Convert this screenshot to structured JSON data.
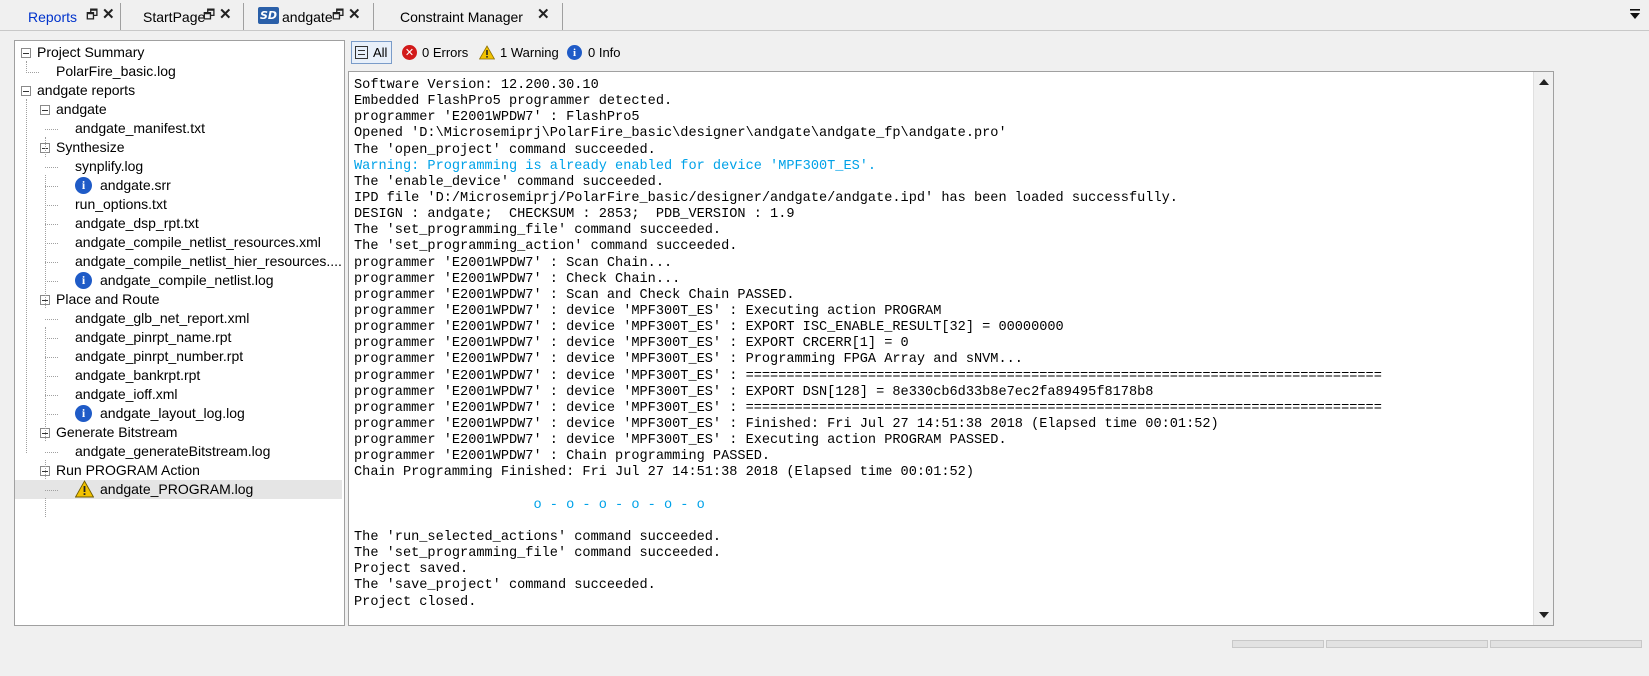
{
  "tabs": [
    {
      "label": "Reports",
      "active": true
    },
    {
      "label": "StartPage",
      "active": false
    },
    {
      "label": "andgate",
      "active": false,
      "badge": "SD"
    },
    {
      "label": "Constraint Manager",
      "active": false
    }
  ],
  "tree": {
    "nodes": [
      {
        "label": "Project Summary",
        "icon": "expander"
      },
      {
        "label": "PolarFire_basic.log",
        "icon": "none"
      },
      {
        "label": "andgate reports",
        "icon": "expander"
      },
      {
        "label": "andgate",
        "icon": "expander"
      },
      {
        "label": "andgate_manifest.txt",
        "icon": "none"
      },
      {
        "label": "Synthesize",
        "icon": "expander"
      },
      {
        "label": "synplify.log",
        "icon": "none"
      },
      {
        "label": "andgate.srr",
        "icon": "info"
      },
      {
        "label": "run_options.txt",
        "icon": "none"
      },
      {
        "label": "andgate_dsp_rpt.txt",
        "icon": "none"
      },
      {
        "label": "andgate_compile_netlist_resources.xml",
        "icon": "none"
      },
      {
        "label": "andgate_compile_netlist_hier_resources....",
        "icon": "none"
      },
      {
        "label": "andgate_compile_netlist.log",
        "icon": "info"
      },
      {
        "label": "Place and Route",
        "icon": "expander"
      },
      {
        "label": "andgate_glb_net_report.xml",
        "icon": "none"
      },
      {
        "label": "andgate_pinrpt_name.rpt",
        "icon": "none"
      },
      {
        "label": "andgate_pinrpt_number.rpt",
        "icon": "none"
      },
      {
        "label": "andgate_bankrpt.rpt",
        "icon": "none"
      },
      {
        "label": "andgate_ioff.xml",
        "icon": "none"
      },
      {
        "label": "andgate_layout_log.log",
        "icon": "info"
      },
      {
        "label": "Generate Bitstream",
        "icon": "expander"
      },
      {
        "label": "andgate_generateBitstream.log",
        "icon": "none"
      },
      {
        "label": "Run PROGRAM Action",
        "icon": "expander"
      },
      {
        "label": "andgate_PROGRAM.log",
        "icon": "warning",
        "selected": true
      }
    ]
  },
  "filters": {
    "all": "All",
    "errors": "0 Errors",
    "warnings": "1 Warning",
    "info": "0 Info"
  },
  "log": {
    "lines": [
      {
        "text": "Software Version: 12.200.30.10",
        "kind": "normal"
      },
      {
        "text": "Embedded FlashPro5 programmer detected.",
        "kind": "normal"
      },
      {
        "text": "programmer 'E2001WPDW7' : FlashPro5",
        "kind": "normal"
      },
      {
        "text": "Opened 'D:\\Microsemiprj\\PolarFire_basic\\designer\\andgate\\andgate_fp\\andgate.pro'",
        "kind": "normal"
      },
      {
        "text": "The 'open_project' command succeeded.",
        "kind": "normal"
      },
      {
        "text": "Warning: Programming is already enabled for device 'MPF300T_ES'.",
        "kind": "warn"
      },
      {
        "text": "The 'enable_device' command succeeded.",
        "kind": "normal"
      },
      {
        "text": "IPD file 'D:/Microsemiprj/PolarFire_basic/designer/andgate/andgate.ipd' has been loaded successfully.",
        "kind": "normal"
      },
      {
        "text": "DESIGN : andgate;  CHECKSUM : 2853;  PDB_VERSION : 1.9",
        "kind": "normal"
      },
      {
        "text": "The 'set_programming_file' command succeeded.",
        "kind": "normal"
      },
      {
        "text": "The 'set_programming_action' command succeeded.",
        "kind": "normal"
      },
      {
        "text": "programmer 'E2001WPDW7' : Scan Chain...",
        "kind": "normal"
      },
      {
        "text": "programmer 'E2001WPDW7' : Check Chain...",
        "kind": "normal"
      },
      {
        "text": "programmer 'E2001WPDW7' : Scan and Check Chain PASSED.",
        "kind": "normal"
      },
      {
        "text": "programmer 'E2001WPDW7' : device 'MPF300T_ES' : Executing action PROGRAM",
        "kind": "normal"
      },
      {
        "text": "programmer 'E2001WPDW7' : device 'MPF300T_ES' : EXPORT ISC_ENABLE_RESULT[32] = 00000000",
        "kind": "normal"
      },
      {
        "text": "programmer 'E2001WPDW7' : device 'MPF300T_ES' : EXPORT CRCERR[1] = 0",
        "kind": "normal"
      },
      {
        "text": "programmer 'E2001WPDW7' : device 'MPF300T_ES' : Programming FPGA Array and sNVM...",
        "kind": "normal"
      },
      {
        "text": "programmer 'E2001WPDW7' : device 'MPF300T_ES' : ==============================================================================",
        "kind": "normal"
      },
      {
        "text": "programmer 'E2001WPDW7' : device 'MPF300T_ES' : EXPORT DSN[128] = 8e330cb6d33b8e7ec2fa89495f8178b8",
        "kind": "normal"
      },
      {
        "text": "programmer 'E2001WPDW7' : device 'MPF300T_ES' : ==============================================================================",
        "kind": "normal"
      },
      {
        "text": "programmer 'E2001WPDW7' : device 'MPF300T_ES' : Finished: Fri Jul 27 14:51:38 2018 (Elapsed time 00:01:52)",
        "kind": "normal"
      },
      {
        "text": "programmer 'E2001WPDW7' : device 'MPF300T_ES' : Executing action PROGRAM PASSED.",
        "kind": "normal"
      },
      {
        "text": "programmer 'E2001WPDW7' : Chain programming PASSED.",
        "kind": "normal"
      },
      {
        "text": "Chain Programming Finished: Fri Jul 27 14:51:38 2018 (Elapsed time 00:01:52)",
        "kind": "normal"
      },
      {
        "text": "",
        "kind": "normal"
      },
      {
        "text": "                      o - o - o - o - o - o",
        "kind": "sep"
      },
      {
        "text": "",
        "kind": "normal"
      },
      {
        "text": "The 'run_selected_actions' command succeeded.",
        "kind": "normal"
      },
      {
        "text": "The 'set_programming_file' command succeeded.",
        "kind": "normal"
      },
      {
        "text": "Project saved.",
        "kind": "normal"
      },
      {
        "text": "The 'save_project' command succeeded.",
        "kind": "normal"
      },
      {
        "text": "Project closed.",
        "kind": "normal"
      }
    ]
  },
  "colors": {
    "active_tab_text": "#0033cc",
    "warning_text": "#00a2e8",
    "info_icon": "#1f5bc7",
    "error_icon": "#d21a1a",
    "warning_icon": "#f2c200"
  }
}
